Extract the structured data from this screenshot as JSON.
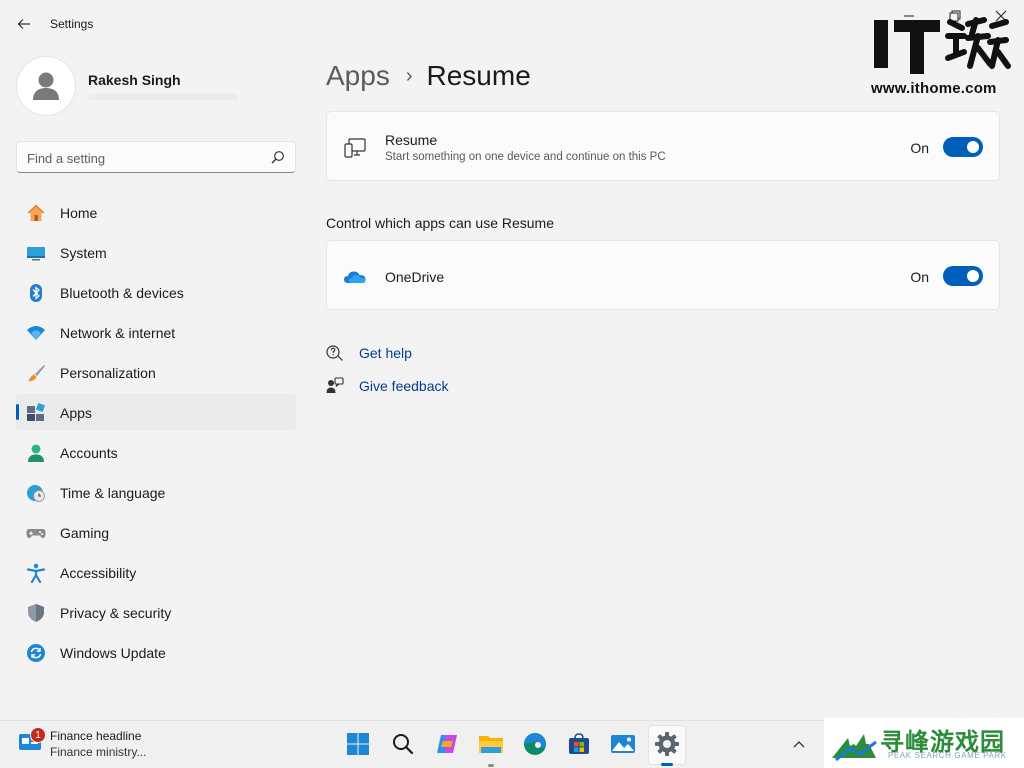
{
  "window": {
    "title": "Settings",
    "back_glyph": "←",
    "minimize_glyph": "—",
    "maximize_glyph": "❐",
    "close_glyph": "✕"
  },
  "watermark": {
    "logo_text": "IT之家",
    "url": "www.ithome.com"
  },
  "profile": {
    "name": "Rakesh Singh"
  },
  "search": {
    "placeholder": "Find a setting"
  },
  "nav": {
    "items": [
      {
        "label": "Home",
        "icon": "home-icon",
        "selected": false
      },
      {
        "label": "System",
        "icon": "system-icon",
        "selected": false
      },
      {
        "label": "Bluetooth & devices",
        "icon": "bluetooth-icon",
        "selected": false
      },
      {
        "label": "Network & internet",
        "icon": "wifi-icon",
        "selected": false
      },
      {
        "label": "Personalization",
        "icon": "brush-icon",
        "selected": false
      },
      {
        "label": "Apps",
        "icon": "apps-icon",
        "selected": true
      },
      {
        "label": "Accounts",
        "icon": "accounts-icon",
        "selected": false
      },
      {
        "label": "Time & language",
        "icon": "time-language-icon",
        "selected": false
      },
      {
        "label": "Gaming",
        "icon": "gaming-icon",
        "selected": false
      },
      {
        "label": "Accessibility",
        "icon": "accessibility-icon",
        "selected": false
      },
      {
        "label": "Privacy & security",
        "icon": "shield-icon",
        "selected": false
      },
      {
        "label": "Windows Update",
        "icon": "update-icon",
        "selected": false
      }
    ]
  },
  "breadcrumb": {
    "parent": "Apps",
    "separator": "›",
    "current": "Resume"
  },
  "resume_card": {
    "title": "Resume",
    "description": "Start something on one device and continue on this PC",
    "state": "On",
    "on": true
  },
  "section": {
    "heading": "Control which apps can use Resume"
  },
  "onedrive_card": {
    "title": "OneDrive",
    "state": "On",
    "on": true
  },
  "links": {
    "help": "Get help",
    "feedback": "Give feedback"
  },
  "taskbar": {
    "news_badge": "1",
    "news_title": "Finance headline",
    "news_sub": "Finance ministry...",
    "chevron_glyph": "^",
    "apps": [
      "start-icon",
      "search-icon",
      "copilot-icon",
      "file-explorer-icon",
      "edge-icon",
      "store-icon",
      "photos-icon",
      "settings-gear-icon"
    ]
  },
  "footer_watermark": {
    "title": "寻峰游戏园",
    "subtitle": "PEAK SEARCH GAME PARK"
  },
  "colors": {
    "accent": "#005fb8",
    "link": "#003e92",
    "background": "#f3f3f3",
    "card": "#fbfbfb"
  }
}
